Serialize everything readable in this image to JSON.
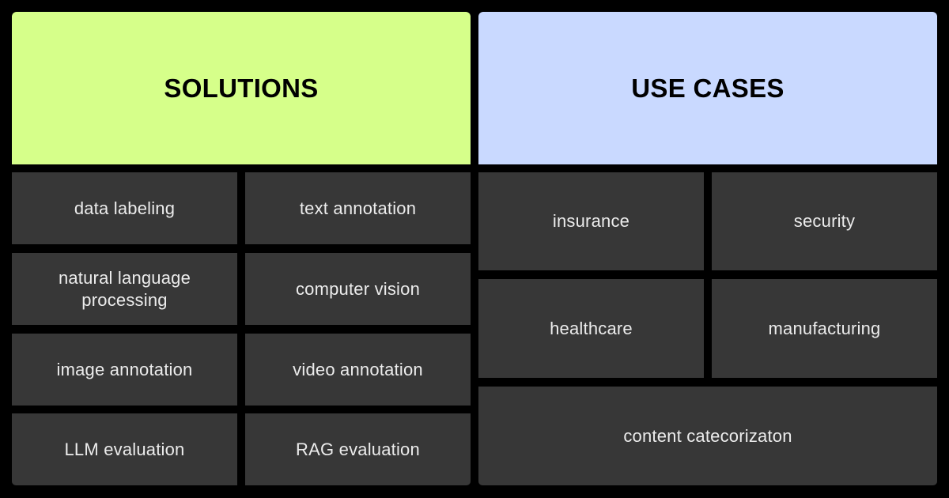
{
  "solutions": {
    "title": "SOLUTIONS",
    "accent_color": "#d6ff8a",
    "items": [
      {
        "label": "data labeling"
      },
      {
        "label": "text annotation"
      },
      {
        "label": "natural language processing"
      },
      {
        "label": "computer vision"
      },
      {
        "label": "image annotation"
      },
      {
        "label": "video annotation"
      },
      {
        "label": "LLM evaluation"
      },
      {
        "label": "RAG evaluation"
      }
    ]
  },
  "use_cases": {
    "title": "USE CASES",
    "accent_color": "#c9d9ff",
    "items": [
      {
        "label": "insurance"
      },
      {
        "label": "security"
      },
      {
        "label": "healthcare"
      },
      {
        "label": "manufacturing"
      },
      {
        "label": "content catecorizaton"
      }
    ]
  },
  "tile_color": "#373737"
}
